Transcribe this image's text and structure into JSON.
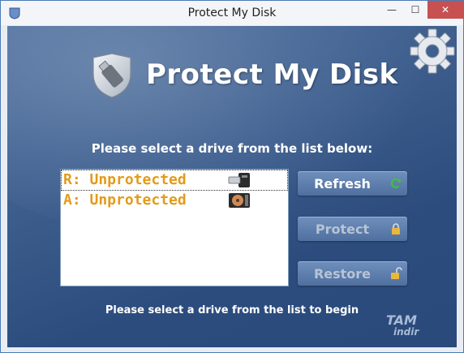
{
  "window": {
    "title": "Protect My Disk",
    "minimize_glyph": "—",
    "maximize_glyph": "☐",
    "close_glyph": "✕"
  },
  "header": {
    "logo_text": "Protect My Disk",
    "logo_icon": "shield-usb-icon",
    "settings_icon": "gear-icon"
  },
  "main": {
    "prompt": "Please select a drive from the list below:",
    "drives": [
      {
        "label": "R: Unprotected",
        "icon": "usb-drive-icon",
        "selected": true
      },
      {
        "label": "A: Unprotected",
        "icon": "removable-disk-icon",
        "selected": false
      }
    ],
    "status": "Please select a drive from the list to begin"
  },
  "buttons": {
    "refresh": {
      "label": "Refresh",
      "icon": "refresh-icon",
      "enabled": true
    },
    "protect": {
      "label": "Protect",
      "icon": "lock-icon",
      "enabled": false
    },
    "restore": {
      "label": "Restore",
      "icon": "unlock-icon",
      "enabled": false
    }
  },
  "watermark": {
    "line1": "TAM",
    "line2": "indir"
  },
  "colors": {
    "background": "#3f5f8e",
    "drive_text": "#e39b1b",
    "button": "#5c7cad",
    "refresh_icon": "#3fbf3f",
    "lock_icon": "#e8b838"
  }
}
